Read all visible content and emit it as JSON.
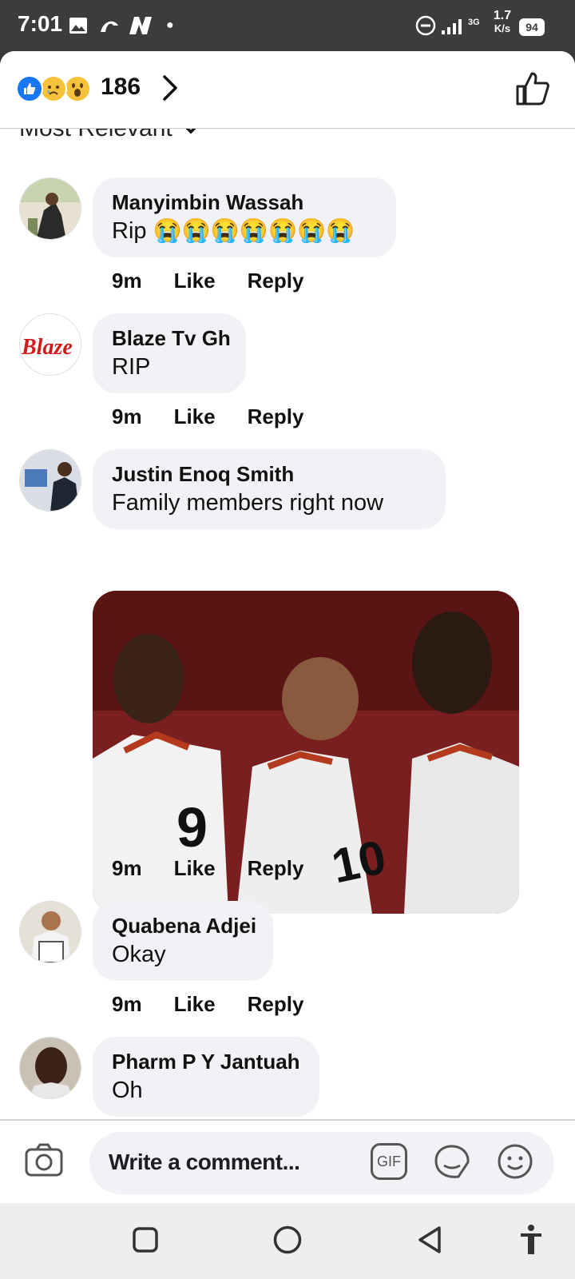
{
  "status_bar": {
    "time": "7:01",
    "network": "3G",
    "speed_value": "1.7",
    "speed_unit": "K/s",
    "battery": "94"
  },
  "reactions": {
    "icons": [
      "like-reaction-icon",
      "sad-reaction-icon",
      "wow-reaction-icon"
    ],
    "count": "186"
  },
  "sort": {
    "label": "Most Relevant"
  },
  "comments": [
    {
      "name": "Manyimbin Wassah",
      "text": "Rip 😭😭😭😭😭😭😭",
      "time": "9m",
      "like": "Like",
      "reply": "Reply"
    },
    {
      "name": "Blaze Tv Gh",
      "text": "RIP",
      "time": "9m",
      "like": "Like",
      "reply": "Reply",
      "avatar_logo": "Blaze"
    },
    {
      "name": "Justin Enoq Smith",
      "text": "Family members right now",
      "time": "9m",
      "like": "Like",
      "reply": "Reply",
      "photo_jerseys": [
        "9",
        "10"
      ]
    },
    {
      "name": "Quabena Adjei",
      "text": "Okay",
      "time": "9m",
      "like": "Like",
      "reply": "Reply"
    },
    {
      "name": "Pharm P Y Jantuah",
      "text": "Oh"
    }
  ],
  "composer": {
    "placeholder": "Write a comment...",
    "gif_label": "GIF"
  },
  "colors": {
    "accent": "#1877f2",
    "bubble": "#f0f2f5",
    "status_bar": "#3c3c3c"
  }
}
